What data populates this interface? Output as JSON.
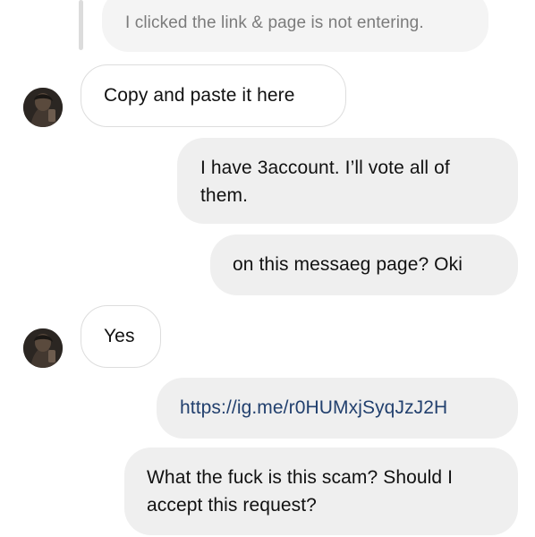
{
  "thread": {
    "messages": [
      {
        "id": "m0",
        "side": "sent",
        "kind": "quoted-reply",
        "text": "I clicked the link & page is not entering."
      },
      {
        "id": "m1",
        "side": "received",
        "text": "Copy and paste it here"
      },
      {
        "id": "m2",
        "side": "sent",
        "text": "I have 3account. I’ll vote all of them."
      },
      {
        "id": "m3",
        "side": "sent",
        "text": "on this messaeg page? Oki"
      },
      {
        "id": "m4",
        "side": "received",
        "text": "Yes"
      },
      {
        "id": "m5",
        "side": "sent",
        "kind": "link",
        "text": "https://ig.me/r0HUMxjSyqJzJ2H"
      },
      {
        "id": "m6",
        "side": "sent",
        "text": "What the fuck is this scam? Should I accept this request?"
      }
    ]
  },
  "colors": {
    "sent_bubble": "#efefef",
    "received_border": "#dddddd",
    "quoted_text": "#7b7b7b",
    "link_text": "#22406e"
  },
  "icons": {
    "avatar": "contact-avatar-photo"
  }
}
